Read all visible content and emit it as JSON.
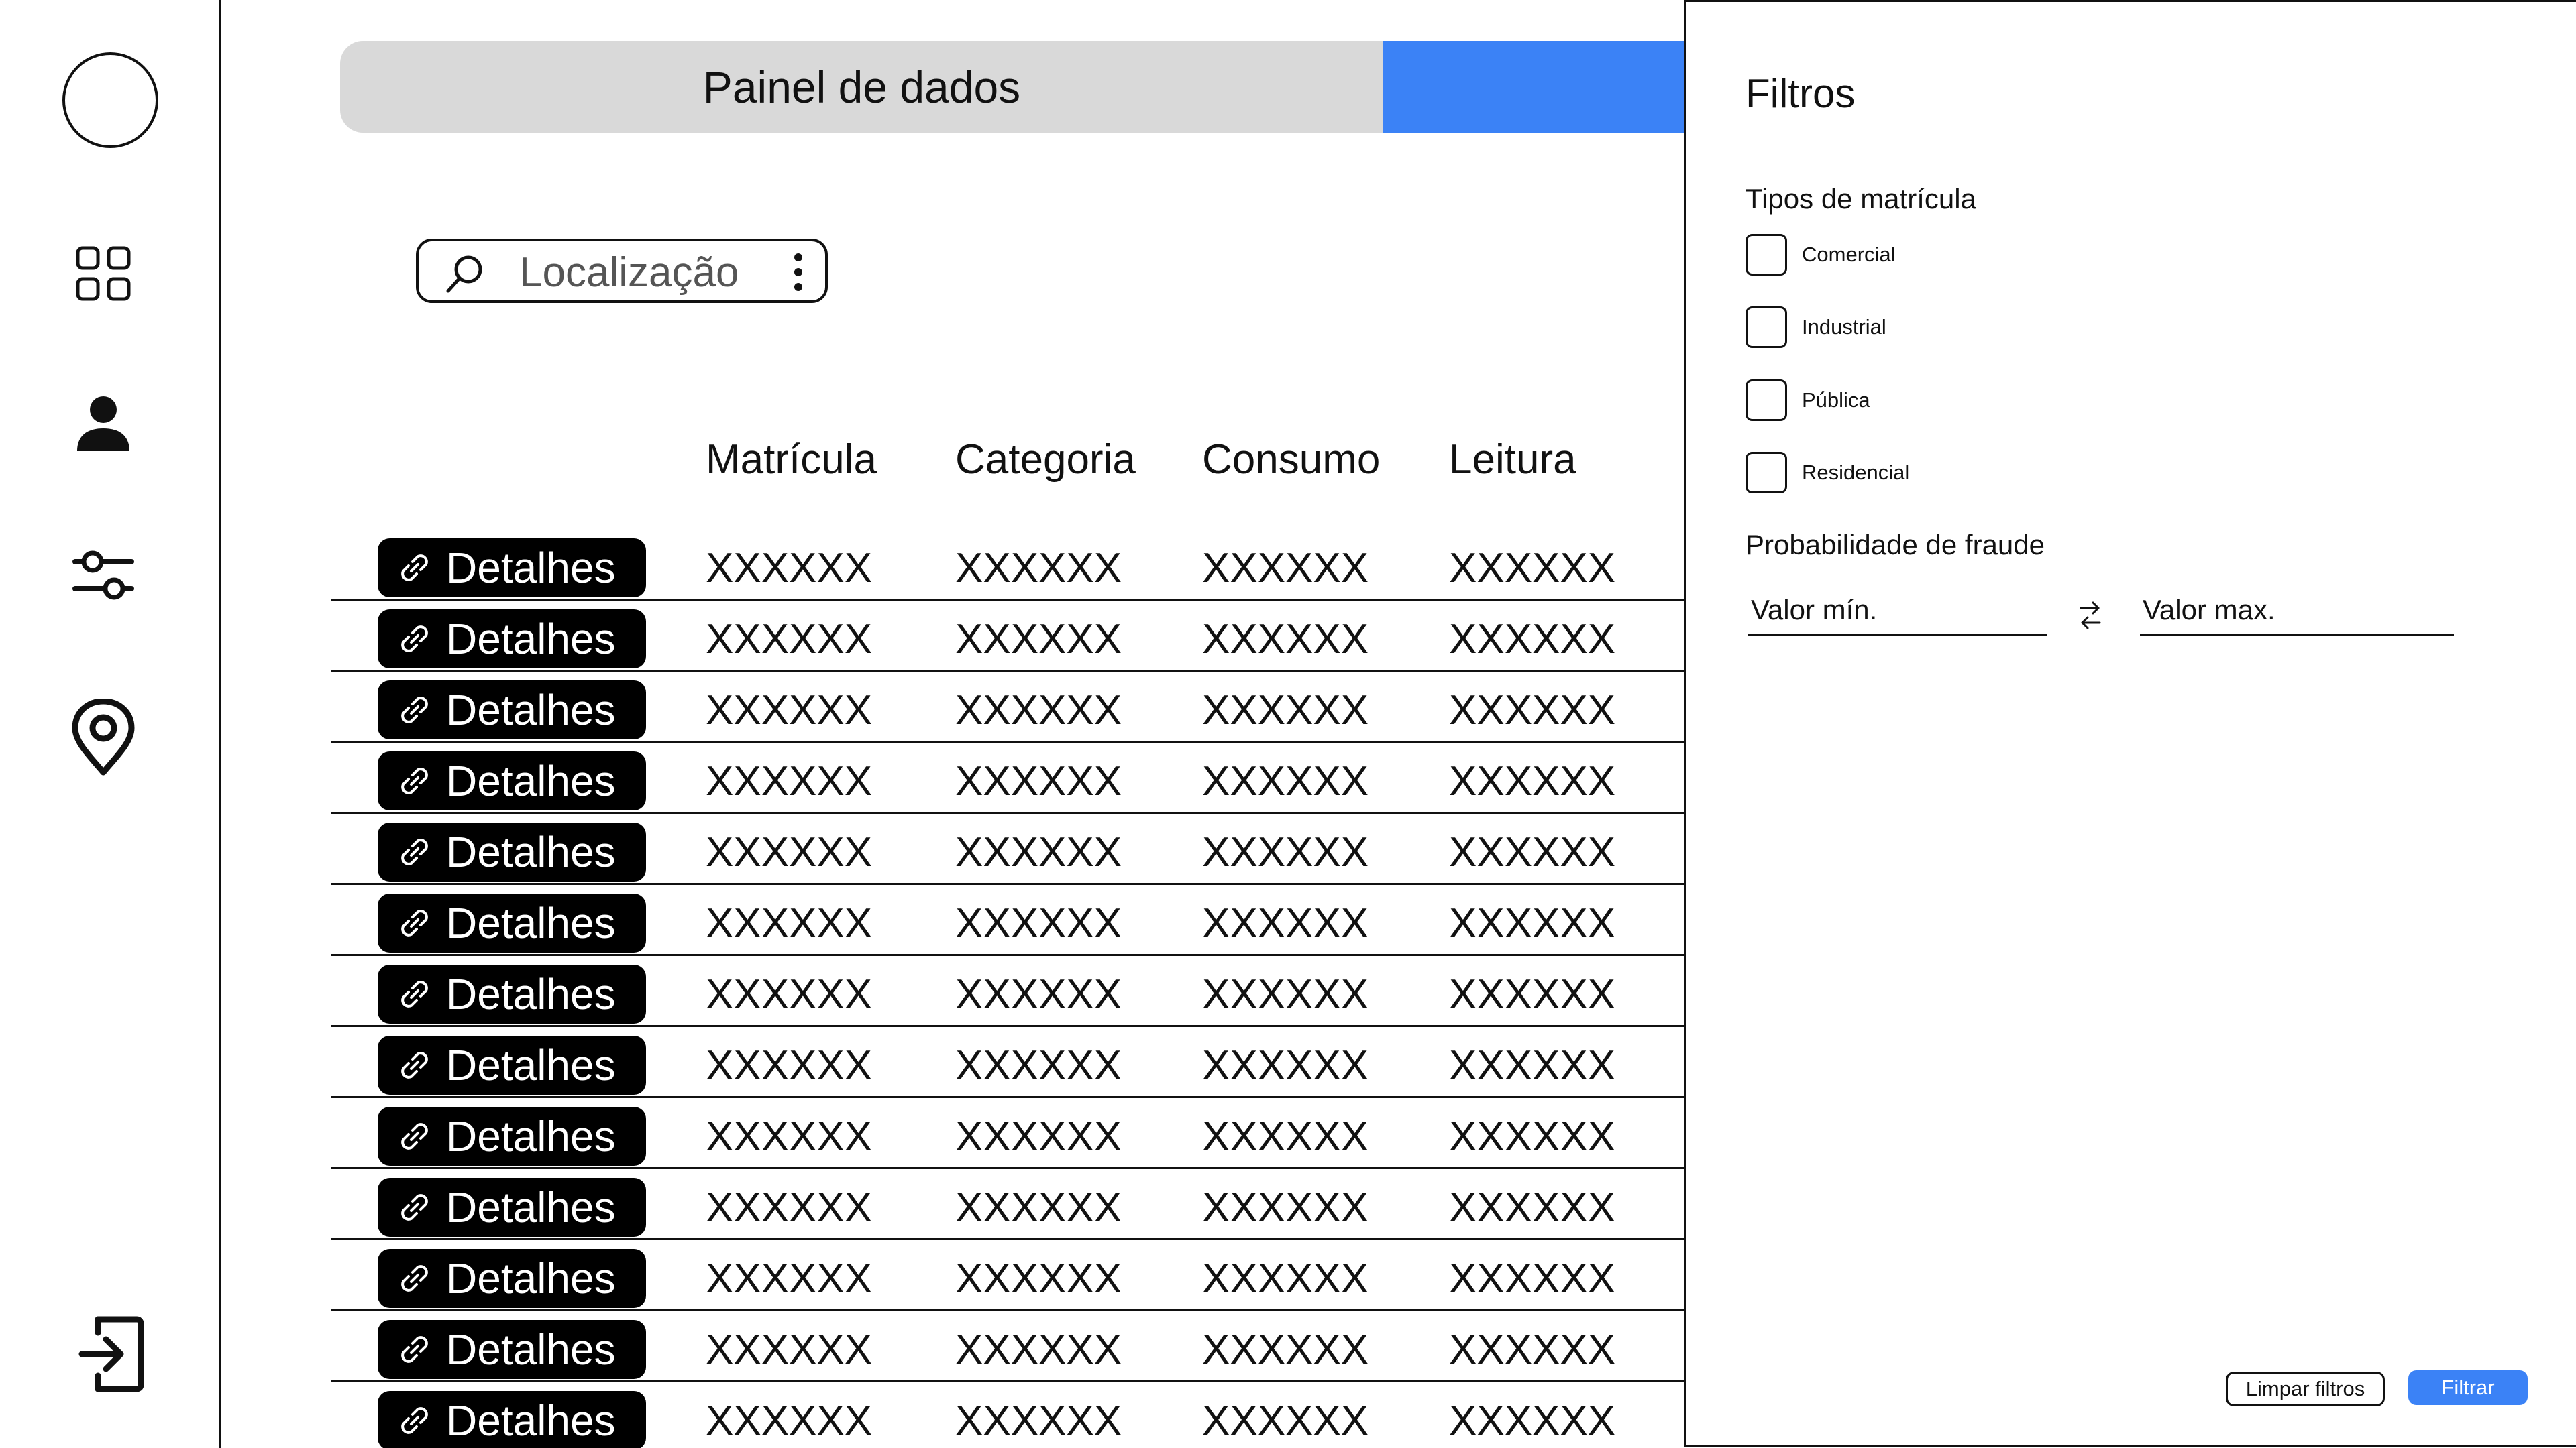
{
  "header": {
    "title": "Painel de dados"
  },
  "search": {
    "placeholder": "Localização"
  },
  "table": {
    "columns": [
      "Matrícula",
      "Categoria",
      "Consumo",
      "Leitura"
    ],
    "details_label": "Detalhes",
    "rows": [
      [
        "XXXXXX",
        "XXXXXX",
        "XXXXXX",
        "XXXXXX"
      ],
      [
        "XXXXXX",
        "XXXXXX",
        "XXXXXX",
        "XXXXXX"
      ],
      [
        "XXXXXX",
        "XXXXXX",
        "XXXXXX",
        "XXXXXX"
      ],
      [
        "XXXXXX",
        "XXXXXX",
        "XXXXXX",
        "XXXXXX"
      ],
      [
        "XXXXXX",
        "XXXXXX",
        "XXXXXX",
        "XXXXXX"
      ],
      [
        "XXXXXX",
        "XXXXXX",
        "XXXXXX",
        "XXXXXX"
      ],
      [
        "XXXXXX",
        "XXXXXX",
        "XXXXXX",
        "XXXXXX"
      ],
      [
        "XXXXXX",
        "XXXXXX",
        "XXXXXX",
        "XXXXXX"
      ],
      [
        "XXXXXX",
        "XXXXXX",
        "XXXXXX",
        "XXXXXX"
      ],
      [
        "XXXXXX",
        "XXXXXX",
        "XXXXXX",
        "XXXXXX"
      ],
      [
        "XXXXXX",
        "XXXXXX",
        "XXXXXX",
        "XXXXXX"
      ],
      [
        "XXXXXX",
        "XXXXXX",
        "XXXXXX",
        "XXXXXX"
      ],
      [
        "XXXXXX",
        "XXXXXX",
        "XXXXXX",
        "XXXXXX"
      ]
    ]
  },
  "sidebar": {
    "icons": [
      "dashboard-icon",
      "user-icon",
      "settings-sliders-icon",
      "location-pin-icon",
      "logout-icon"
    ]
  },
  "filters": {
    "title": "Filtros",
    "types_title": "Tipos de matrícula",
    "types": [
      "Comercial",
      "Industrial",
      "Pública",
      "Residencial"
    ],
    "fraud_title": "Probabilidade de fraude",
    "min_placeholder": "Valor mín.",
    "max_placeholder": "Valor max.",
    "clear_label": "Limpar filtros",
    "apply_label": "Filtrar"
  },
  "colors": {
    "accent": "#3b82f6",
    "bar": "#d9d9d9",
    "text": "#111111"
  }
}
